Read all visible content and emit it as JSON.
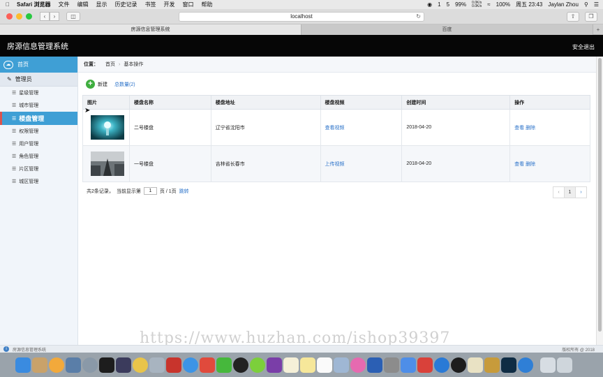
{
  "menubar": {
    "app_name": "Safari 浏览器",
    "items": [
      "文件",
      "编辑",
      "显示",
      "历史记录",
      "书签",
      "开发",
      "窗口",
      "帮助"
    ],
    "status": {
      "qq_count": "1",
      "notify_count": "5",
      "battery": "99%",
      "net_up": "0.0K/s",
      "net_down": "0.0K/s",
      "battery_pct": "100%",
      "clock": "周五 23:43",
      "user": "Jaylan Zhou"
    }
  },
  "browser": {
    "url": "localhost",
    "tabs": [
      {
        "label": "房源信息管理系统",
        "active": true
      },
      {
        "label": "百度",
        "active": false
      }
    ]
  },
  "header": {
    "title": "房源信息管理系统",
    "logout": "安全退出"
  },
  "sidebar": {
    "home": "首页",
    "group": "管理员",
    "items": [
      {
        "label": "星级管理",
        "active": false
      },
      {
        "label": "城市管理",
        "active": false
      },
      {
        "label": "楼盘管理",
        "active": true
      },
      {
        "label": "权限管理",
        "active": false
      },
      {
        "label": "用户管理",
        "active": false
      },
      {
        "label": "角色管理",
        "active": false
      },
      {
        "label": "片区管理",
        "active": false
      },
      {
        "label": "城区管理",
        "active": false
      }
    ]
  },
  "breadcrumb": {
    "label": "位置：",
    "home": "首页",
    "current": "基本操作"
  },
  "actions": {
    "new_label": "新建",
    "total_label": "总数量(2)"
  },
  "table": {
    "headers": [
      "图片",
      "楼盘名称",
      "楼盘地址",
      "楼盘视频",
      "创建时间",
      "操作"
    ],
    "rows": [
      {
        "name": "二号楼盘",
        "address": "辽宁省沈阳市",
        "video": "查看视频",
        "created": "2018-04-20",
        "view": "查看",
        "delete": "删除"
      },
      {
        "name": "一号楼盘",
        "address": "吉林省长春市",
        "video": "上传视频",
        "created": "2018-04-20",
        "view": "查看",
        "delete": "删除"
      }
    ]
  },
  "pager": {
    "summary": "共2条记录，",
    "current_label": "当前显示第",
    "page_value": "1",
    "page_suffix": "页 / 1页",
    "jump": "跳转",
    "current_page": "1"
  },
  "statusbar": {
    "left": "房源信息管理系统",
    "right": "版权所有 @ 2018"
  },
  "watermark": "https://www.huzhan.com/ishop39397",
  "colors": {
    "accent": "#3f9fd5",
    "header_bg": "#060606",
    "link": "#2a72c9"
  }
}
